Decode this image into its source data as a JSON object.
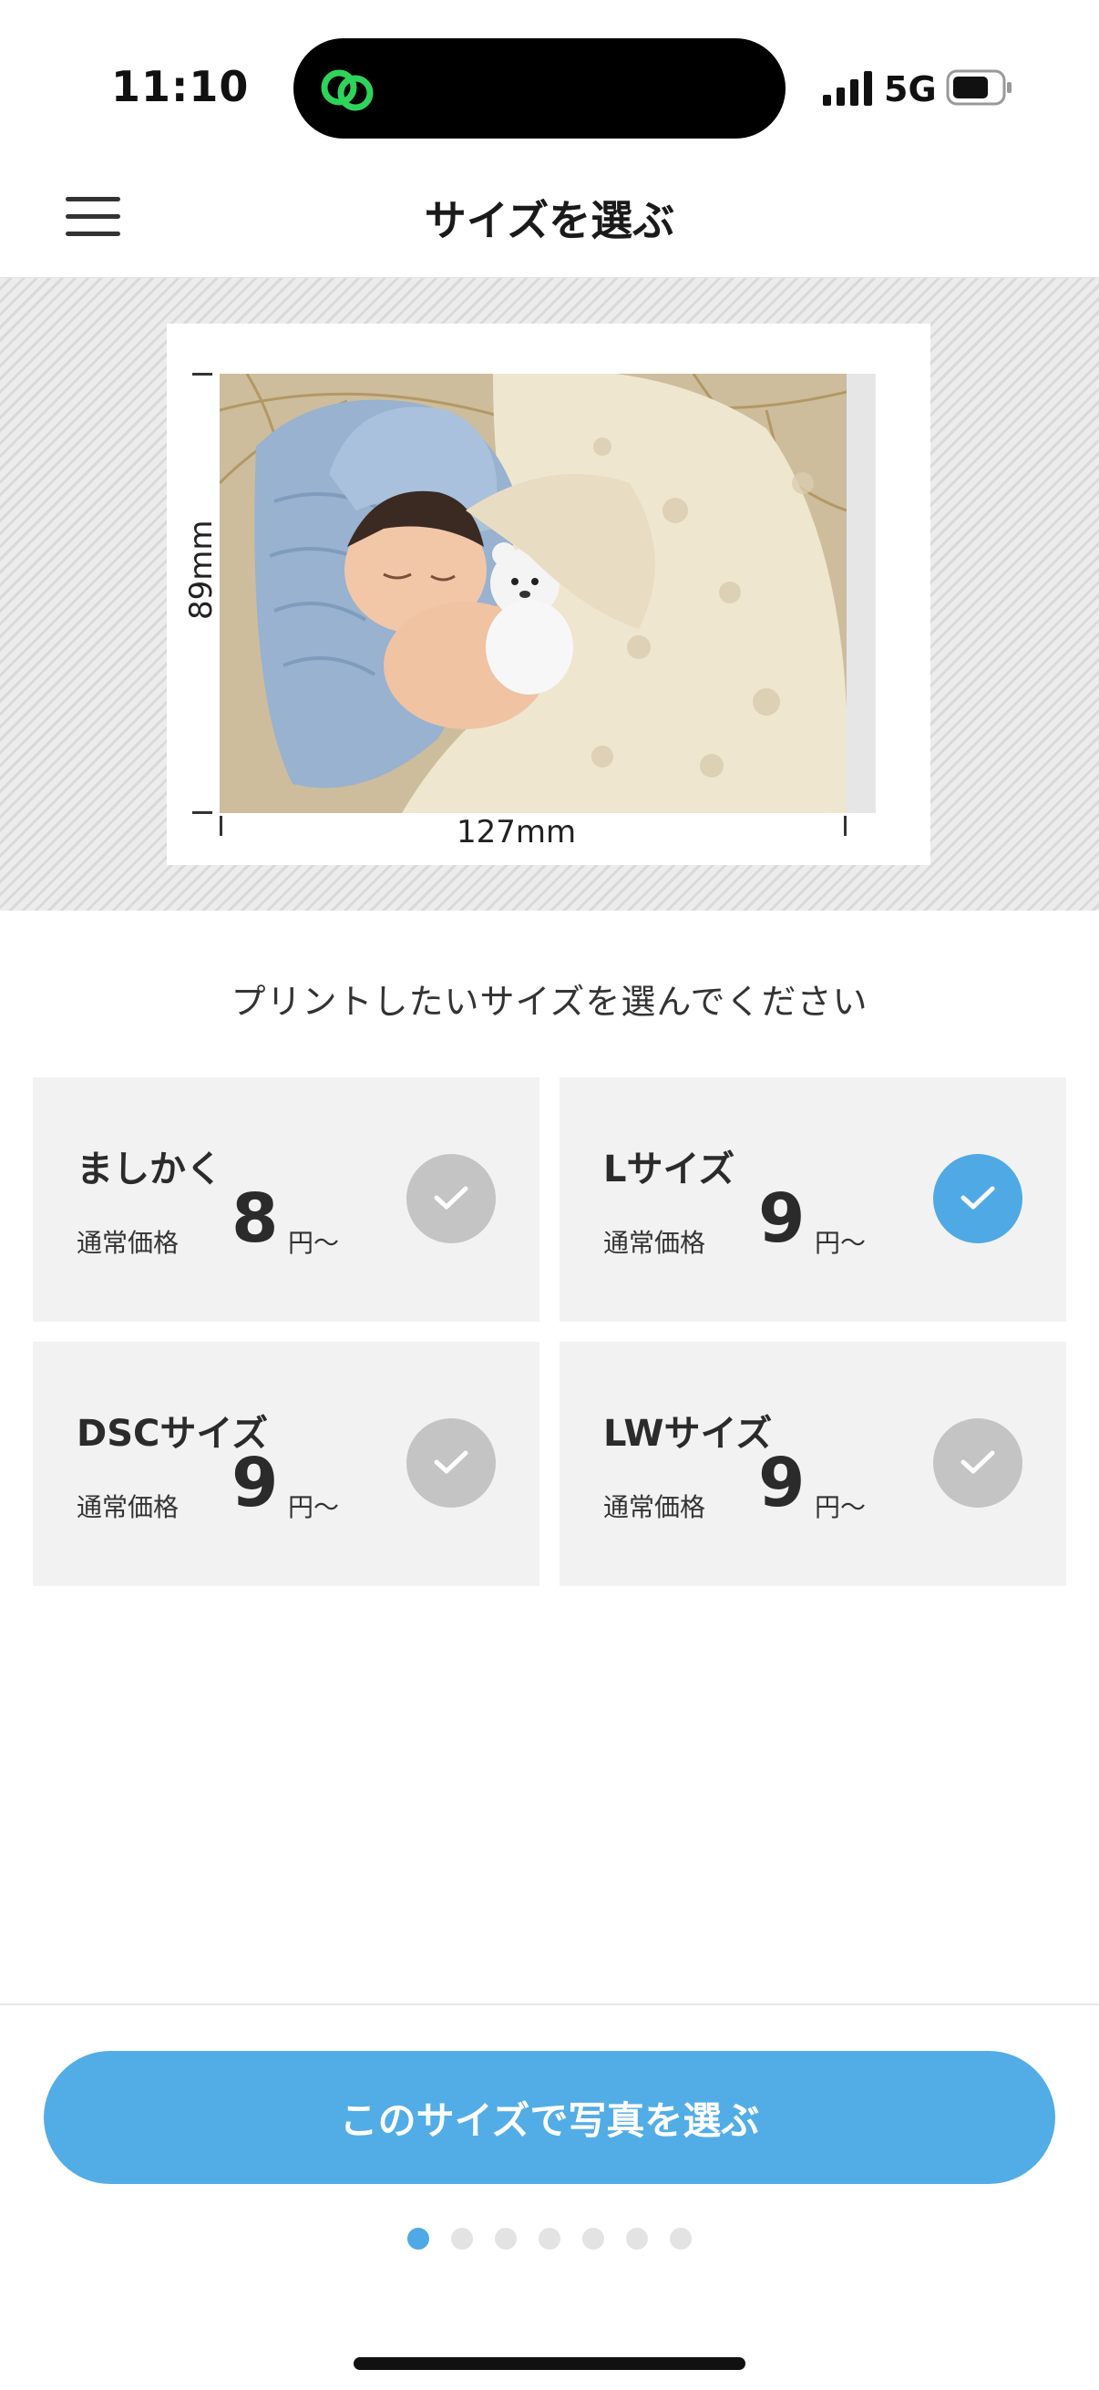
{
  "status_bar": {
    "time": "11:10",
    "network": "5G"
  },
  "header": {
    "title": "サイズを選ぶ",
    "menu_icon": "hamburger-menu-icon"
  },
  "preview": {
    "height_label": "89mm",
    "width_label": "127mm",
    "photo_description_icon": "baby-photo-image"
  },
  "instruction": "プリントしたいサイズを選んでください",
  "sizes": [
    {
      "name": "ましかく",
      "price_label": "通常価格",
      "price": "8",
      "unit": "円〜",
      "selected": false
    },
    {
      "name": "Lサイズ",
      "price_label": "通常価格",
      "price": "9",
      "unit": "円〜",
      "selected": true
    },
    {
      "name": "DSCサイズ",
      "price_label": "通常価格",
      "price": "9",
      "unit": "円〜",
      "selected": false
    },
    {
      "name": "LWサイズ",
      "price_label": "通常価格",
      "price": "9",
      "unit": "円〜",
      "selected": false
    }
  ],
  "cta": {
    "label": "このサイズで写真を選ぶ"
  },
  "pagination": {
    "total": 7,
    "current": 1
  },
  "colors": {
    "accent": "#4fa9e4",
    "card_bg": "#f2f2f2",
    "check_inactive": "#c4c4c4"
  }
}
